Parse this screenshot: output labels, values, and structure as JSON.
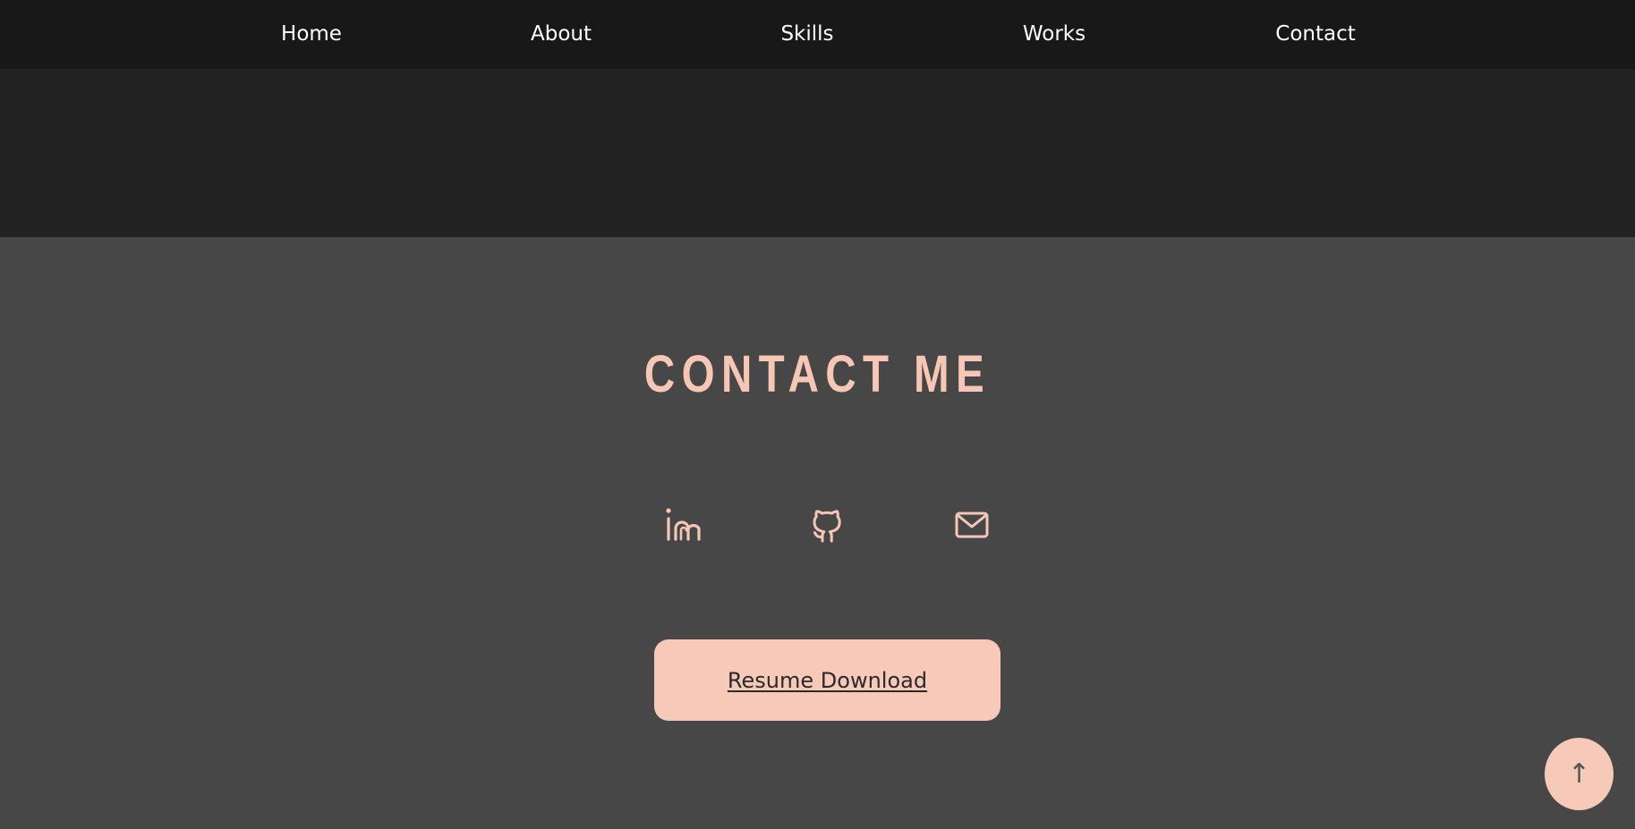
{
  "nav": {
    "items": [
      {
        "label": "Home"
      },
      {
        "label": "About"
      },
      {
        "label": "Skills"
      },
      {
        "label": "Works"
      },
      {
        "label": "Contact"
      }
    ]
  },
  "contact": {
    "title": "CONTACT ME",
    "social": [
      {
        "icon": "linkedin-icon"
      },
      {
        "icon": "github-icon"
      },
      {
        "icon": "mail-icon"
      }
    ],
    "resume_label": "Resume Download"
  },
  "scroll_top": {
    "icon": "arrow-up-icon",
    "glyph": "↑"
  },
  "colors": {
    "nav_bg": "#181818",
    "hero_bg": "#222222",
    "section_bg": "#474747",
    "accent": "#f7c7b6",
    "button_text": "#2a2a2a"
  }
}
